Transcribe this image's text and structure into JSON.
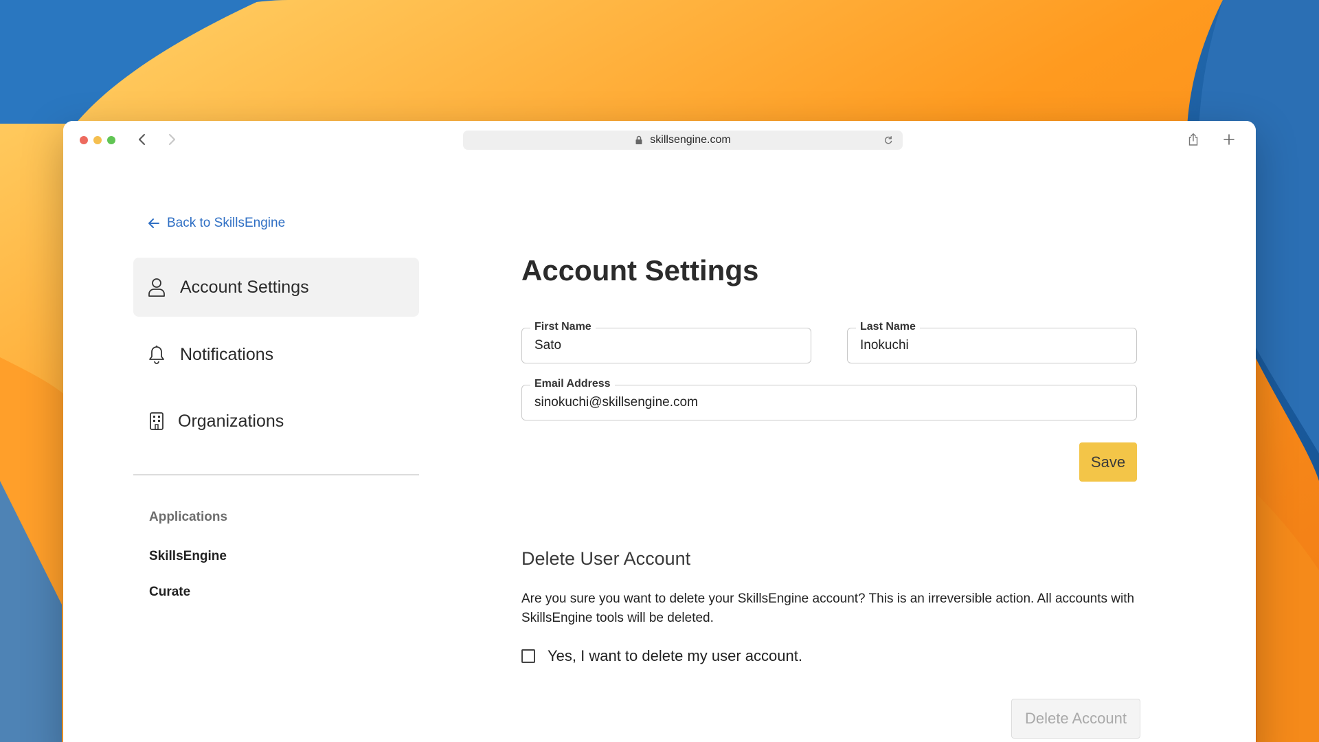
{
  "browser": {
    "url": "skillsengine.com"
  },
  "sidebar": {
    "back_link": "Back to SkillsEngine",
    "items": [
      {
        "label": "Account Settings",
        "icon": "person-icon",
        "active": true
      },
      {
        "label": "Notifications",
        "icon": "bell-icon",
        "active": false
      },
      {
        "label": "Organizations",
        "icon": "building-icon",
        "active": false
      }
    ],
    "applications_heading": "Applications",
    "applications": [
      "SkillsEngine",
      "Curate"
    ]
  },
  "main": {
    "title": "Account Settings",
    "first_name": {
      "label": "First Name",
      "value": "Sato"
    },
    "last_name": {
      "label": "Last Name",
      "value": "Inokuchi"
    },
    "email": {
      "label": "Email Address",
      "value": "sinokuchi@skillsengine.com"
    },
    "save_label": "Save",
    "delete_section": {
      "heading": "Delete User Account",
      "warning": "Are you sure you want to delete your SkillsEngine account? This is an irreversible action. All accounts with SkillsEngine tools will be deleted.",
      "confirm_label": "Yes, I want to delete my user account.",
      "confirm_checked": false,
      "delete_button": "Delete Account"
    }
  },
  "colors": {
    "link": "#2f6fc4",
    "save_button": "#f3c548",
    "active_item_bg": "#f2f2f2"
  }
}
